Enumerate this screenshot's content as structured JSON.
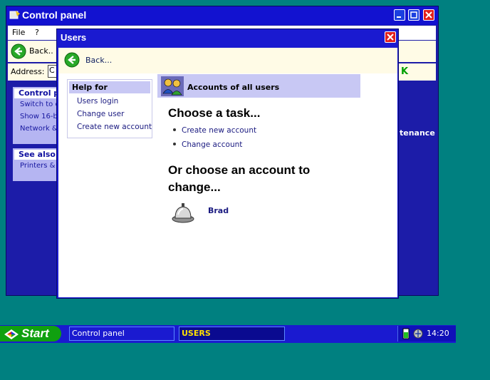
{
  "control_panel": {
    "title": "Control panel",
    "menu": {
      "file": "File",
      "help": "?"
    },
    "toolbar": {
      "back_label": "Back.."
    },
    "address": {
      "label": "Address:",
      "value": "C",
      "go_label": "K"
    },
    "panel_1": {
      "heading": "Control pa",
      "items": [
        "Switch to c",
        "Show 16-b",
        "Network &"
      ]
    },
    "panel_2": {
      "heading": "See also",
      "items": [
        "Printers & f"
      ]
    },
    "maintenance_label": "tenance"
  },
  "users": {
    "title": "Users",
    "toolbar": {
      "back_label": "Back..."
    },
    "help": {
      "heading": "Help for",
      "items": [
        "Users login",
        "Change user",
        "Create new account"
      ]
    },
    "accounts_header": "Accounts of all users",
    "task_heading": "Choose a task...",
    "tasks": [
      "Create new account",
      "Change account"
    ],
    "choose_heading": "Or choose an account to change...",
    "accounts": [
      {
        "name": "Brad",
        "icon": "bell-avatar-icon"
      }
    ]
  },
  "taskbar": {
    "start_label": "Start",
    "tasks": [
      "Control panel",
      "USERS"
    ],
    "clock": "14:20"
  },
  "colors": {
    "desktop": "#008080",
    "titlebar": "#1212d0",
    "toolbar_bg": "#fffbe6",
    "accent_panel": "#c8c8f4",
    "link": "#1a1a80",
    "start_green": "#10a010",
    "close_red": "#e0201c"
  }
}
